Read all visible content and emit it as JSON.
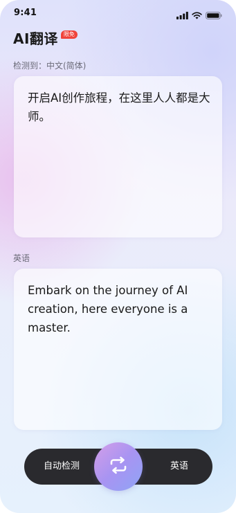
{
  "status_bar": {
    "time": "9:41"
  },
  "header": {
    "title": "AI翻译",
    "badge": "限免"
  },
  "source": {
    "detected_label": "检测到：中文(简体)",
    "text": "开启AI创作旅程，在这里人人都是大师。"
  },
  "target": {
    "language_label": "英语",
    "text": "Embark on the journey of AI creation, here everyone is a master."
  },
  "language_bar": {
    "from_language": "自动检测",
    "to_language": "英语",
    "swap_icon": "swap-icon"
  },
  "colors": {
    "badge": "#f0433a",
    "bar_background": "#2a2a2e",
    "swap_gradient_start": "#d49ee8",
    "swap_gradient_end": "#8ea4f6"
  }
}
